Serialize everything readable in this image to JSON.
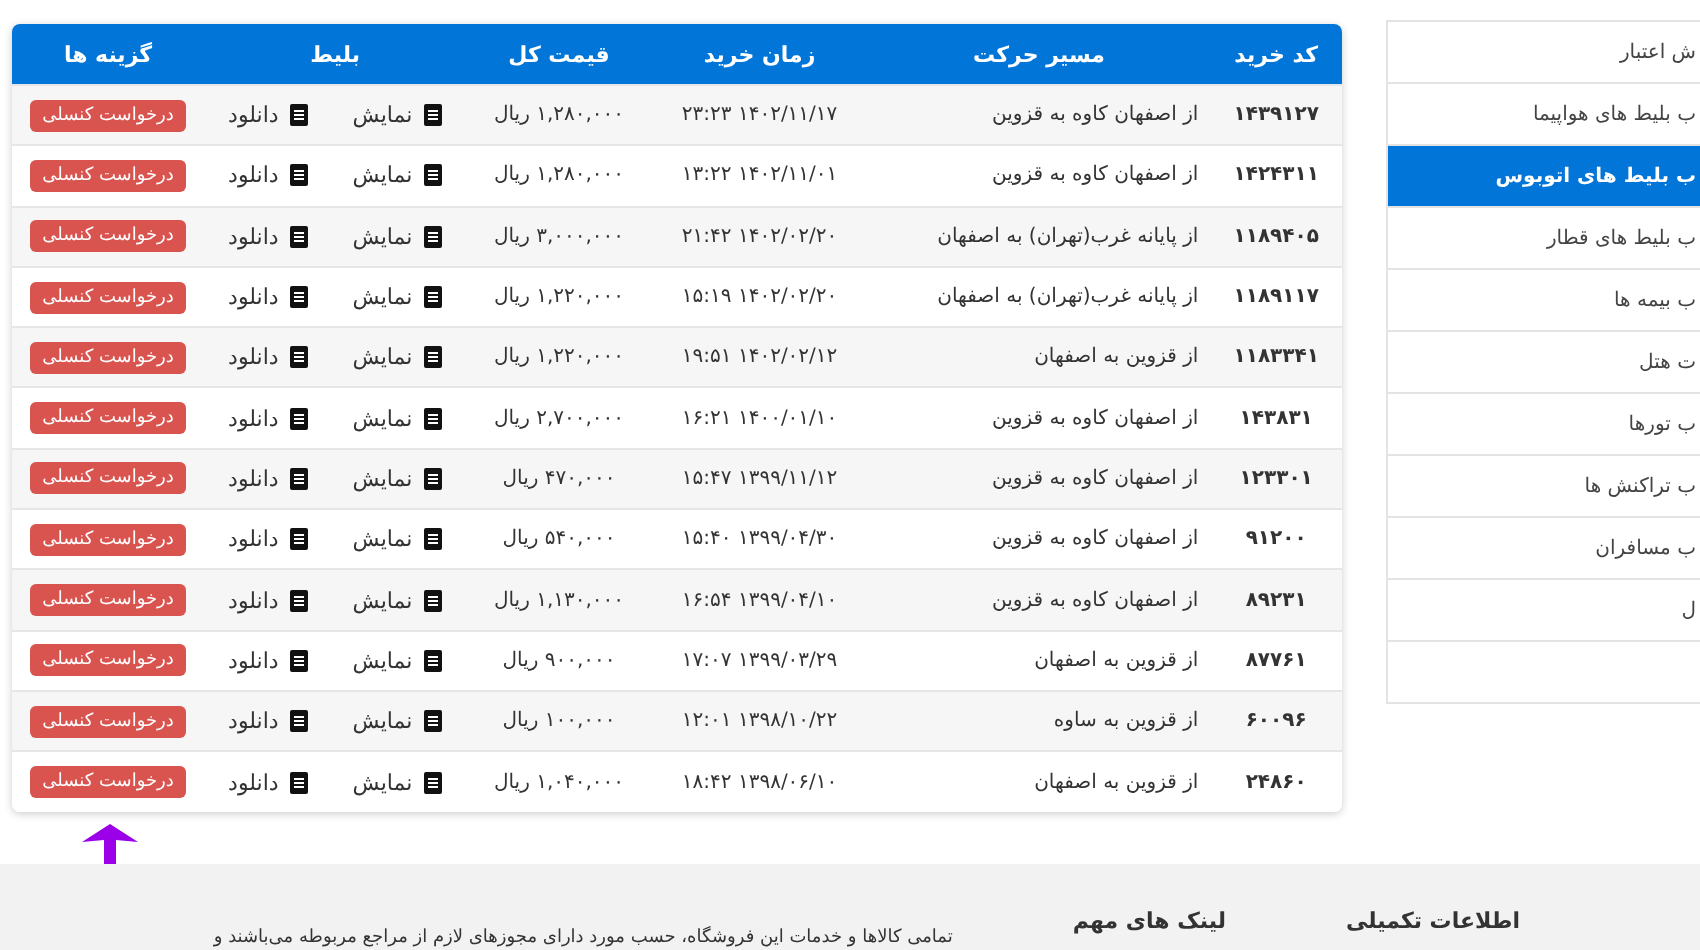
{
  "table": {
    "columns": [
      "کد خرید",
      "مسیر حرکت",
      "زمان خرید",
      "قیمت کل",
      "بلیط",
      "گزینه ها"
    ],
    "rows": [
      {
        "code": "۱۴۳۹۱۲۷",
        "route": "از اصفهان کاوه به قزوین",
        "time": "۱۴۰۲/۱۱/۱۷ ۲۳:۲۳",
        "price": "۱,۲۸۰,۰۰۰ ریال",
        "show": "نمایش",
        "download": "دانلود",
        "cancel": "درخواست کنسلی"
      },
      {
        "code": "۱۴۲۴۳۱۱",
        "route": "از اصفهان کاوه به قزوین",
        "time": "۱۴۰۲/۱۱/۰۱ ۱۳:۲۲",
        "price": "۱,۲۸۰,۰۰۰ ریال",
        "show": "نمایش",
        "download": "دانلود",
        "cancel": "درخواست کنسلی"
      },
      {
        "code": "۱۱۸۹۴۰۵",
        "route": "از پایانه غرب(تهران) به اصفهان",
        "time": "۱۴۰۲/۰۲/۲۰ ۲۱:۴۲",
        "price": "۳,۰۰۰,۰۰۰ ریال",
        "show": "نمایش",
        "download": "دانلود",
        "cancel": "درخواست کنسلی"
      },
      {
        "code": "۱۱۸۹۱۱۷",
        "route": "از پایانه غرب(تهران) به اصفهان",
        "time": "۱۴۰۲/۰۲/۲۰ ۱۵:۱۹",
        "price": "۱,۲۲۰,۰۰۰ ریال",
        "show": "نمایش",
        "download": "دانلود",
        "cancel": "درخواست کنسلی"
      },
      {
        "code": "۱۱۸۳۳۴۱",
        "route": "از قزوین به اصفهان",
        "time": "۱۴۰۲/۰۲/۱۲ ۱۹:۵۱",
        "price": "۱,۲۲۰,۰۰۰ ریال",
        "show": "نمایش",
        "download": "دانلود",
        "cancel": "درخواست کنسلی"
      },
      {
        "code": "۱۴۳۸۳۱",
        "route": "از اصفهان کاوه به قزوین",
        "time": "۱۴۰۰/۰۱/۱۰ ۱۶:۲۱",
        "price": "۲,۷۰۰,۰۰۰ ریال",
        "show": "نمایش",
        "download": "دانلود",
        "cancel": "درخواست کنسلی"
      },
      {
        "code": "۱۲۳۳۰۱",
        "route": "از اصفهان کاوه به قزوین",
        "time": "۱۳۹۹/۱۱/۱۲ ۱۵:۴۷",
        "price": "۴۷۰,۰۰۰ ریال",
        "show": "نمایش",
        "download": "دانلود",
        "cancel": "درخواست کنسلی"
      },
      {
        "code": "۹۱۲۰۰",
        "route": "از اصفهان کاوه به قزوین",
        "time": "۱۳۹۹/۰۴/۳۰ ۱۵:۴۰",
        "price": "۵۴۰,۰۰۰ ریال",
        "show": "نمایش",
        "download": "دانلود",
        "cancel": "درخواست کنسلی"
      },
      {
        "code": "۸۹۲۳۱",
        "route": "از اصفهان کاوه به قزوین",
        "time": "۱۳۹۹/۰۴/۱۰ ۱۶:۵۴",
        "price": "۱,۱۳۰,۰۰۰ ریال",
        "show": "نمایش",
        "download": "دانلود",
        "cancel": "درخواست کنسلی"
      },
      {
        "code": "۸۷۷۶۱",
        "route": "از قزوین به اصفهان",
        "time": "۱۳۹۹/۰۳/۲۹ ۱۷:۰۷",
        "price": "۹۰۰,۰۰۰ ریال",
        "show": "نمایش",
        "download": "دانلود",
        "cancel": "درخواست کنسلی"
      },
      {
        "code": "۶۰۰۹۶",
        "route": "از قزوین به ساوه",
        "time": "۱۳۹۸/۱۰/۲۲ ۱۲:۰۱",
        "price": "۱۰۰,۰۰۰ ریال",
        "show": "نمایش",
        "download": "دانلود",
        "cancel": "درخواست کنسلی"
      },
      {
        "code": "۲۴۸۶۰",
        "route": "از قزوین به اصفهان",
        "time": "۱۳۹۸/۰۶/۱۰ ۱۸:۴۲",
        "price": "۱,۰۴۰,۰۰۰ ریال",
        "show": "نمایش",
        "download": "دانلود",
        "cancel": "درخواست کنسلی"
      }
    ]
  },
  "sidebar": {
    "items": [
      {
        "label": "ش اعتبار",
        "selected": false
      },
      {
        "label": "ب بلیط های هواپیما",
        "selected": false
      },
      {
        "label": "ب بلیط های اتوبوس",
        "selected": true
      },
      {
        "label": "ب بلیط های قطار",
        "selected": false
      },
      {
        "label": "ب بیمه ها",
        "selected": false
      },
      {
        "label": "ت هتل",
        "selected": false
      },
      {
        "label": "ب تورها",
        "selected": false
      },
      {
        "label": "ب تراکنش ها",
        "selected": false
      },
      {
        "label": "ب مسافران",
        "selected": false
      },
      {
        "label": "ل",
        "selected": false
      }
    ]
  },
  "footer": {
    "headings": [
      "اطلاعات تکمیلی",
      "لینک های مهم"
    ],
    "text": "تمامی کالاها و خدمات این فروشگاه، حسب مورد دارای مجوزهای لازم از مراجع مربوطه می‌باشند و"
  }
}
